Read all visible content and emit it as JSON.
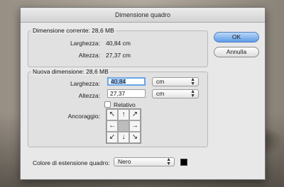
{
  "dialog": {
    "title": "Dimensione quadro",
    "current": {
      "label": "Dimensione corrente: 28,6 MB",
      "width_label": "Larghezza:",
      "width_value": "40,84 cm",
      "height_label": "Altezza:",
      "height_value": "27,37 cm"
    },
    "new": {
      "label": "Nuova dimensione: 28,6 MB",
      "width_label": "Larghezza:",
      "width_value": "40,84",
      "width_unit": "cm",
      "height_label": "Altezza:",
      "height_value": "27,37",
      "height_unit": "cm",
      "relative_label": "Relativo",
      "anchor_label": "Ancoraggio:"
    },
    "extension": {
      "label": "Colore di estensione quadro:",
      "value": "Nero",
      "swatch_color": "#000000"
    },
    "buttons": {
      "ok": "OK",
      "cancel": "Annulla"
    }
  },
  "colors": {
    "primary_button": "#5d9de8",
    "focus": "#6aa5e8"
  }
}
